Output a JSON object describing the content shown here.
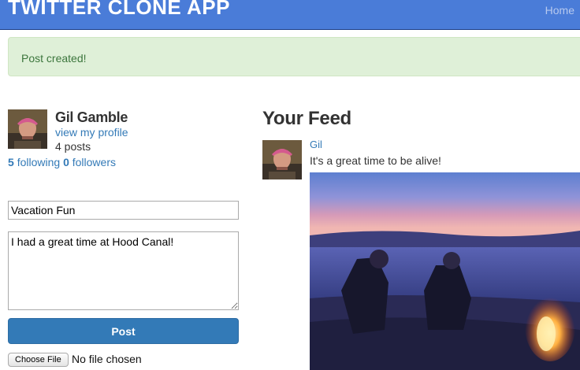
{
  "navbar": {
    "brand": "TWITTER CLONE APP",
    "home_link": "Home"
  },
  "alert": {
    "message": "Post created!"
  },
  "profile": {
    "name": "Gil Gamble",
    "profile_link": "view my profile",
    "posts_count": "4 posts",
    "following_count": "5",
    "following_label": "following",
    "followers_count": "0",
    "followers_label": "followers"
  },
  "compose": {
    "title_value": "Vacation Fun",
    "content_value": "I had a great time at Hood Canal!",
    "post_button": "Post",
    "file_button": "Choose File",
    "file_status": "No file chosen"
  },
  "feed": {
    "title": "Your Feed",
    "items": [
      {
        "author": "Gil",
        "text": "It's a great time to be alive!"
      }
    ]
  },
  "colors": {
    "navbar": "#4a7cd8",
    "link": "#337ab7",
    "alert_bg": "#dff0d8",
    "alert_text": "#3c763d",
    "button": "#337ab7"
  }
}
